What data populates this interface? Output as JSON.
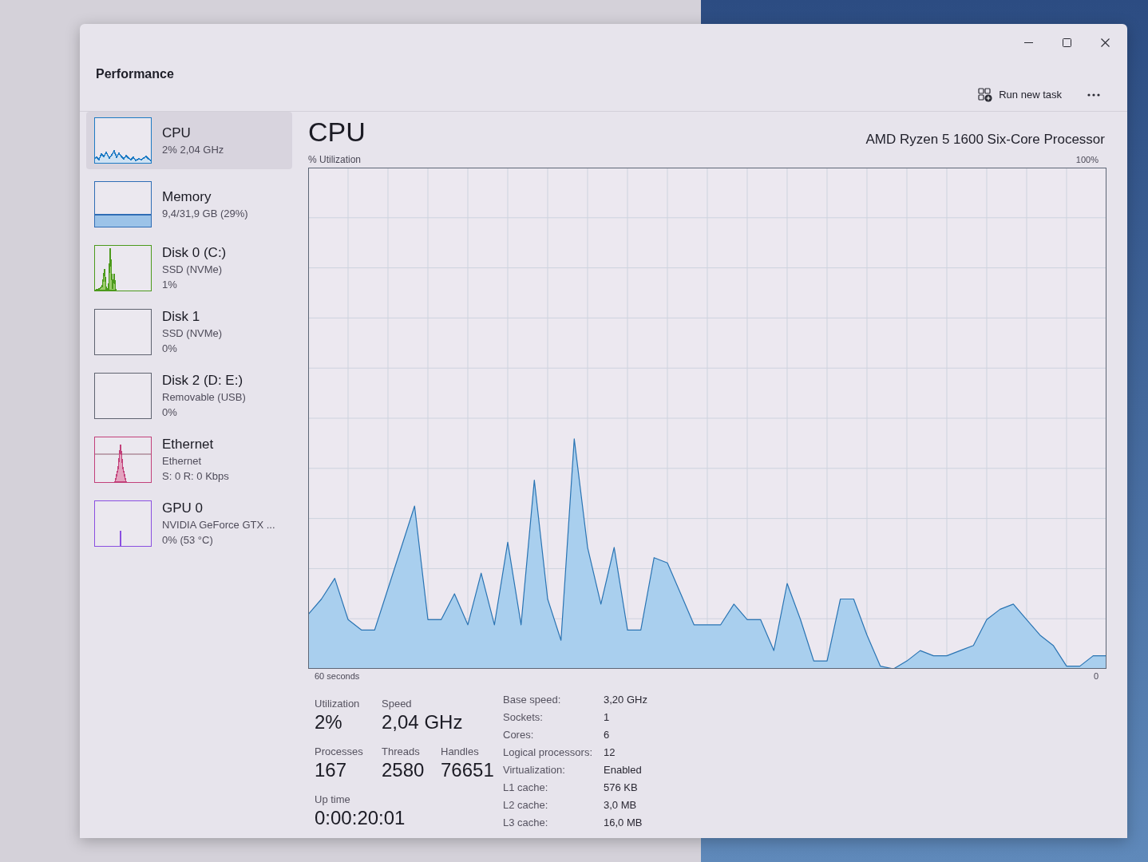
{
  "header": {
    "title": "Performance",
    "actions": [
      {
        "label": "Run new task"
      }
    ]
  },
  "sidebar": {
    "items": [
      {
        "title": "CPU",
        "details": [
          "2% 2,04 GHz"
        ],
        "kind": "wave",
        "color": "#1e7bc4",
        "selected": true
      },
      {
        "title": "Memory",
        "details": [
          "9,4/31,9 GB (29%)"
        ],
        "kind": "fill",
        "color": "#2f6db5",
        "selected": false
      },
      {
        "title": "Disk 0 (C:)",
        "details": [
          "SSD (NVMe)",
          "1%"
        ],
        "kind": "peaks",
        "color": "#4c9a1c",
        "selected": false
      },
      {
        "title": "Disk 1",
        "details": [
          "SSD (NVMe)",
          "0%"
        ],
        "kind": "empty",
        "selected": false
      },
      {
        "title": "Disk 2 (D: E:)",
        "details": [
          "Removable (USB)",
          "0%"
        ],
        "kind": "empty",
        "selected": false
      },
      {
        "title": "Ethernet",
        "details": [
          "Ethernet",
          "S: 0 R: 0 Kbps"
        ],
        "kind": "peak",
        "color": "#c2407a",
        "selected": false
      },
      {
        "title": "GPU 0",
        "details": [
          "NVIDIA GeForce GTX ...",
          "0% (53 °C)"
        ],
        "kind": "spike",
        "color": "#8a4fe0",
        "selected": false
      }
    ]
  },
  "detail": {
    "title": "CPU",
    "subtitle": "AMD Ryzen 5 1600 Six-Core Processor",
    "chart_data": {
      "type": "area",
      "ylabel": "% Utilization",
      "xlabel": "60 seconds",
      "ylim": [
        0,
        100
      ],
      "yticks": [
        {
          "value": 0,
          "label": "0"
        },
        {
          "value": 100,
          "label": "100%"
        }
      ],
      "grid": true,
      "values": [
        12,
        15,
        19,
        11,
        9,
        9,
        17,
        25,
        33,
        11,
        11,
        16,
        10,
        20,
        10,
        26,
        10,
        38,
        15,
        7,
        46,
        25,
        14,
        25,
        9,
        9,
        23,
        22,
        16,
        10,
        10,
        10,
        14,
        11,
        11,
        5,
        18,
        11,
        3,
        3,
        15,
        15,
        8,
        2,
        1,
        3,
        5,
        4,
        4,
        5,
        6,
        11,
        13,
        14,
        11,
        8,
        6,
        2,
        2,
        4,
        4
      ]
    },
    "stat_rows": [
      [
        {
          "label": "Utilization",
          "value": "2%"
        },
        {
          "label": "Speed",
          "value": "2,04 GHz"
        }
      ],
      [
        {
          "label": "Processes",
          "value": "167"
        },
        {
          "label": "Threads",
          "value": "2580"
        },
        {
          "label": "Handles",
          "value": "76651"
        }
      ],
      [
        {
          "label": "Up time",
          "value": "0:00:20:01"
        }
      ]
    ],
    "specs": [
      {
        "label": "Base speed:",
        "value": "3,20 GHz"
      },
      {
        "label": "Sockets:",
        "value": "1"
      },
      {
        "label": "Cores:",
        "value": "6"
      },
      {
        "label": "Logical processors:",
        "value": "12"
      },
      {
        "label": "Virtualization:",
        "value": "Enabled"
      },
      {
        "label": "L1 cache:",
        "value": "576 KB"
      },
      {
        "label": "L2 cache:",
        "value": "3,0 MB"
      },
      {
        "label": "L3 cache:",
        "value": "16,0 MB"
      }
    ]
  }
}
